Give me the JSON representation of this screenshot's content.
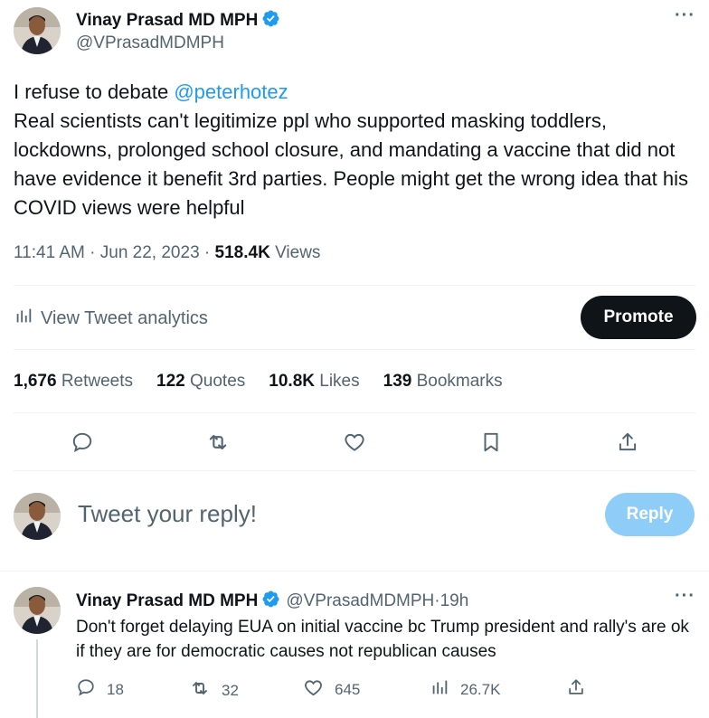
{
  "main_tweet": {
    "author_name": "Vinay Prasad MD MPH",
    "handle": "@VPrasadMDMPH",
    "more_icon": "more-horizontal-icon",
    "text_intro": "I refuse to debate ",
    "mention": "@peterhotez",
    "text_body": "Real scientists can't legitimize ppl who supported masking toddlers, lockdowns, prolonged school closure, and mandating a vaccine that did not have evidence it benefit 3rd parties. People might get the wrong idea that his COVID views were helpful",
    "time": "11:41 AM",
    "sep1": " · ",
    "date": "Jun 22, 2023",
    "sep2": " · ",
    "views_count": "518.4K",
    "views_label": " Views"
  },
  "analytics": {
    "label": "View Tweet analytics",
    "promote_label": "Promote"
  },
  "stats": {
    "retweets_count": "1,676",
    "retweets_label": " Retweets",
    "quotes_count": "122",
    "quotes_label": " Quotes",
    "likes_count": "10.8K",
    "likes_label": " Likes",
    "bookmarks_count": "139",
    "bookmarks_label": " Bookmarks"
  },
  "compose": {
    "placeholder": "Tweet your reply!",
    "reply_button": "Reply"
  },
  "reply_tweet": {
    "author_name": "Vinay Prasad MD MPH",
    "handle": "@VPrasadMDMPH",
    "sep": " · ",
    "age": "19h",
    "text": "Don't forget delaying EUA on initial vaccine bc Trump president and rally's are ok if they are for democratic causes not republican causes",
    "replies": "18",
    "retweets": "32",
    "likes": "645",
    "views": "26.7K"
  },
  "colors": {
    "accent": "#1d9bf0",
    "text": "#0f1419",
    "secondary": "#536471",
    "promote_bg": "#0f1419",
    "reply_disabled_bg": "#8ecdf7"
  }
}
